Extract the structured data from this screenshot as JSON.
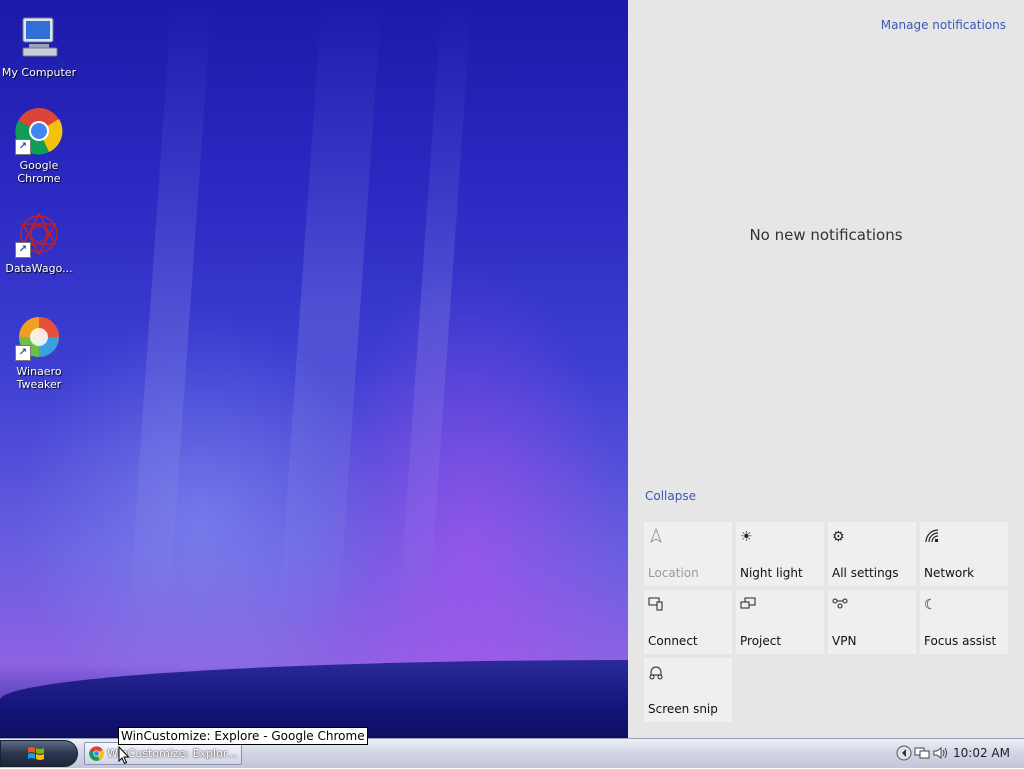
{
  "desktop_icons": [
    {
      "label": "My Computer",
      "icon": "my-computer-icon"
    },
    {
      "label_line1": "Google",
      "label_line2": "Chrome",
      "icon": "chrome-icon"
    },
    {
      "label": "DataWago...",
      "icon": "datawagon-icon"
    },
    {
      "label_line1": "Winaero",
      "label_line2": "Tweaker",
      "icon": "winaero-tweaker-icon"
    }
  ],
  "action_center": {
    "manage_notifications": "Manage notifications",
    "no_notifications": "No new notifications",
    "collapse": "Collapse",
    "tiles": [
      {
        "label": "Location",
        "icon": "location-icon",
        "enabled": false
      },
      {
        "label": "Night light",
        "icon": "night-light-icon",
        "enabled": true
      },
      {
        "label": "All settings",
        "icon": "gear-icon",
        "enabled": true
      },
      {
        "label": "Network",
        "icon": "network-icon",
        "enabled": true
      },
      {
        "label": "Connect",
        "icon": "connect-icon",
        "enabled": true
      },
      {
        "label": "Project",
        "icon": "project-icon",
        "enabled": true
      },
      {
        "label": "VPN",
        "icon": "vpn-icon",
        "enabled": true
      },
      {
        "label": "Focus assist",
        "icon": "moon-icon",
        "enabled": true
      },
      {
        "label": "Screen snip",
        "icon": "screen-snip-icon",
        "enabled": true
      }
    ]
  },
  "taskbar": {
    "start_icon": "windows-logo-icon",
    "task_label": "WinCustomize: Explor...",
    "tooltip": "WinCustomize: Explore - Google Chrome",
    "clock": "10:02 AM",
    "tray_icons": [
      "speaker-icon",
      "network-icon",
      "volume-icon"
    ]
  },
  "colors": {
    "link": "#3a57b8",
    "action_center_bg": "#e6e6e6",
    "tile_bg": "#efefef"
  }
}
